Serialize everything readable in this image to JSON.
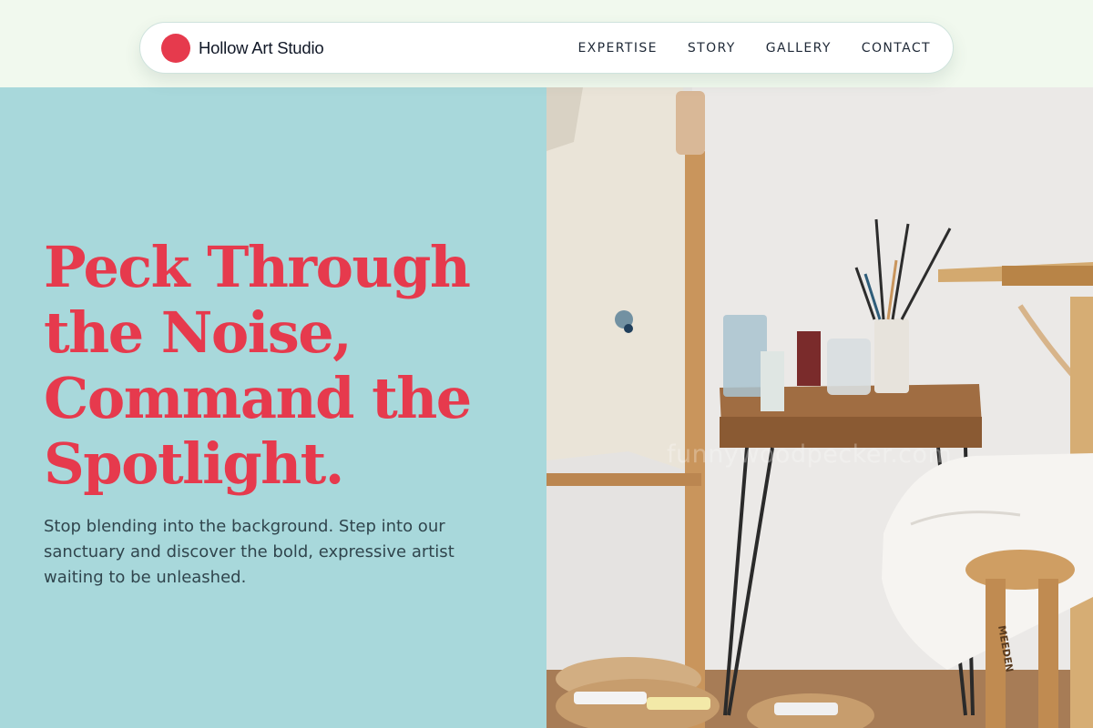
{
  "header": {
    "brand_name": "Hollow Art Studio",
    "brand_color": "#e63a4d",
    "nav": [
      {
        "label": "EXPERTISE"
      },
      {
        "label": "STORY"
      },
      {
        "label": "GALLERY"
      },
      {
        "label": "CONTACT"
      }
    ]
  },
  "hero": {
    "title": "Peck Through the Noise, Command the Spotlight.",
    "subtitle": "Stop blending into the background. Step into our sanctuary and discover the bold, expressive artist waiting to be unleashed.",
    "background": "#a8d8db",
    "accent": "#e63a4d"
  },
  "photo": {
    "subject": "art studio corner with easel, paint brushes, stool and paint tubes",
    "watermark": "funnywoodpecker.com",
    "stool_brand": "MEEDEN"
  }
}
